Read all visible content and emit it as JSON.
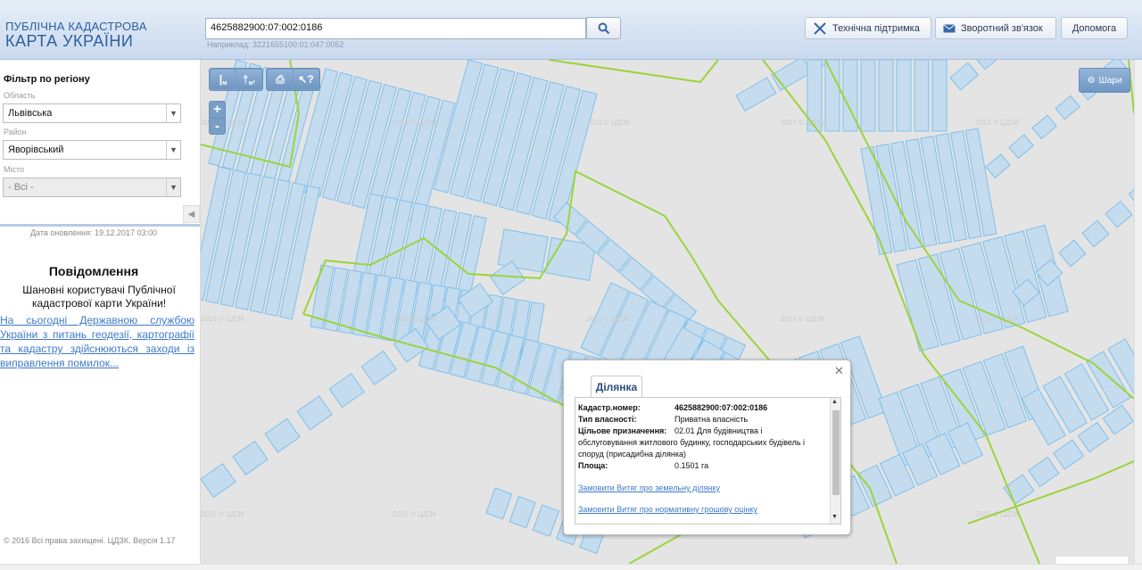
{
  "header": {
    "logo_line1": "ПУБЛІЧНА КАДАСТРОВА",
    "logo_line2": "КАРТА УКРАЇНИ",
    "search_value": "4625882900:07:002:0186",
    "example_text": "Наприклад: 3221655100:01:047:0052",
    "buttons": {
      "support": "Технічна підтримка",
      "feedback": "Зворотний зв'язок",
      "help": "Допомога"
    }
  },
  "sidebar": {
    "filter_title": "Фільтр по регіону",
    "oblast_label": "Область",
    "oblast_value": "Львівська",
    "rayon_label": "Район",
    "rayon_value": "Яворівський",
    "misto_label": "Місто",
    "misto_value": "- Всі -",
    "update_text": "Дата оновлення: 19.12.2017 03:00",
    "news_title": "Повідомлення",
    "news_text": "Шановні користувачі Публічної кадастрової карти України!",
    "news_link": "На сьогодні Державною службою України з питань геодезії, картографії та кадастру здійснюються заходи із виправлення помилок...",
    "copyright": "© 2016 Всі права захищені. ЦДЗК. Версія 1.17"
  },
  "map": {
    "layers_label": "Шари",
    "watermark": "2015 © ЦДЗК",
    "colors": {
      "background": "#e4e4e4",
      "parcel_fill": "#c5dcef",
      "parcel_stroke": "#7fbfe8",
      "boundary": "#9bd43a"
    }
  },
  "popup": {
    "tab_label": "Ділянка",
    "rows": [
      {
        "key": "Кадастр.номер:",
        "value": "4625882900:07:002:0186"
      },
      {
        "key": "Тип власності:",
        "value": "Приватна власність"
      },
      {
        "key": "Цільове призначення:",
        "value": "02.01 Для будівництва і"
      },
      {
        "key": "",
        "value": "обслуговування житлового будинку, господарських будівель і"
      },
      {
        "key": "",
        "value": "споруд (присадибна ділянка)"
      },
      {
        "key": "Площа:",
        "value": "0.1501 га"
      }
    ],
    "link1": "Замовити Витяг про земельну ділянку",
    "link2": "Замовити Витяг про нормативну грошову оцінку"
  }
}
